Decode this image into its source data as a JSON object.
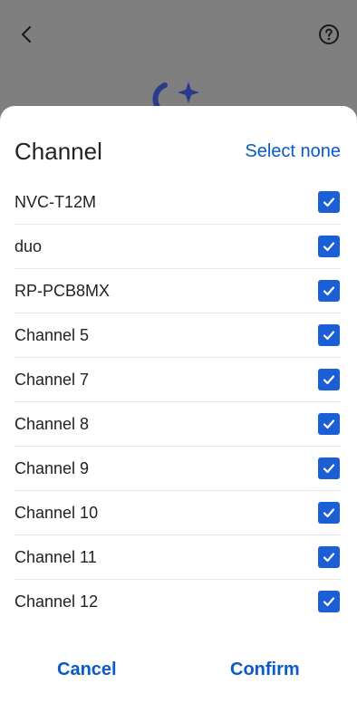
{
  "background": {
    "back_icon": "chevron-left-icon",
    "help_icon": "question-circle-icon",
    "logo_icon": "moon-sparkle-icon",
    "overlay_color": "#7f7f7f",
    "logo_color": "#2a3a8c"
  },
  "sheet": {
    "title": "Channel",
    "select_none_label": "Select none",
    "items": [
      {
        "label": "NVC-T12M",
        "checked": true
      },
      {
        "label": "duo",
        "checked": true
      },
      {
        "label": "RP-PCB8MX",
        "checked": true
      },
      {
        "label": "Channel 5",
        "checked": true
      },
      {
        "label": "Channel 7",
        "checked": true
      },
      {
        "label": "Channel 8",
        "checked": true
      },
      {
        "label": "Channel 9",
        "checked": true
      },
      {
        "label": "Channel 10",
        "checked": true
      },
      {
        "label": "Channel 11",
        "checked": true
      },
      {
        "label": "Channel 12",
        "checked": true
      }
    ],
    "cancel_label": "Cancel",
    "confirm_label": "Confirm",
    "accent_color": "#0a5bc4",
    "checkbox_color": "#1a5fd6"
  }
}
